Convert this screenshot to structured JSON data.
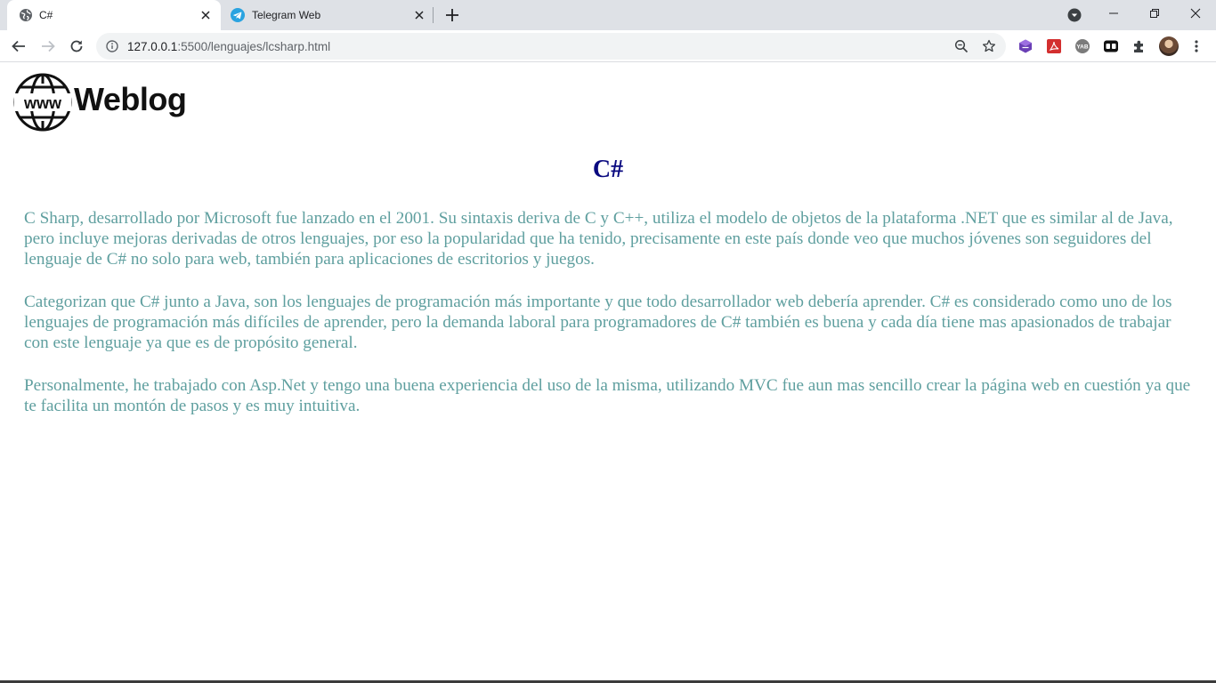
{
  "browser": {
    "tabs": [
      {
        "title": "C#",
        "active": true,
        "icon": "globe-icon"
      },
      {
        "title": "Telegram Web",
        "active": false,
        "icon": "telegram-icon"
      }
    ],
    "address": {
      "host": "127.0.0.1",
      "path": ":5500/lenguajes/lcsharp.html"
    },
    "extensions": [
      "purple-cube-extension-icon",
      "red-pdf-extension-icon",
      "yab-extension-icon",
      "tab-manager-extension-icon",
      "puzzle-extensions-icon"
    ],
    "colors": {
      "tabstrip": "#dee1e6",
      "toolbar": "#ffffff",
      "omnibox": "#f1f3f4"
    }
  },
  "page": {
    "logo": {
      "text": "Weblog",
      "globe_text": "www"
    },
    "heading": "C#",
    "paragraphs": [
      "C Sharp, desarrollado por Microsoft fue lanzado en el 2001. Su sintaxis deriva de C y C++, utiliza el modelo de objetos de la plataforma .NET que es similar al de Java, pero incluye mejoras derivadas de otros lenguajes, por eso la popularidad que ha tenido, precisamente en este país donde veo que muchos jóvenes son seguidores del lenguaje de C# no solo para web, también para aplicaciones de escritorios y juegos.",
      "Categorizan que C# junto a Java, son los lenguajes de programación más importante y que todo desarrollador web debería aprender. C# es considerado como uno de los lenguajes de programación más difíciles de aprender, pero la demanda laboral para programadores de C# también es buena y cada día tiene mas apasionados de trabajar con este lenguaje ya que es de propósito general.",
      "Personalmente, he trabajado con Asp.Net y tengo una buena experiencia del uso de la misma, utilizando MVC fue aun mas sencillo crear la página web en cuestión ya que te facilita un montón de pasos y es muy intuitiva."
    ],
    "colors": {
      "heading": "#0a0a80",
      "text": "#5f9f9f"
    }
  }
}
